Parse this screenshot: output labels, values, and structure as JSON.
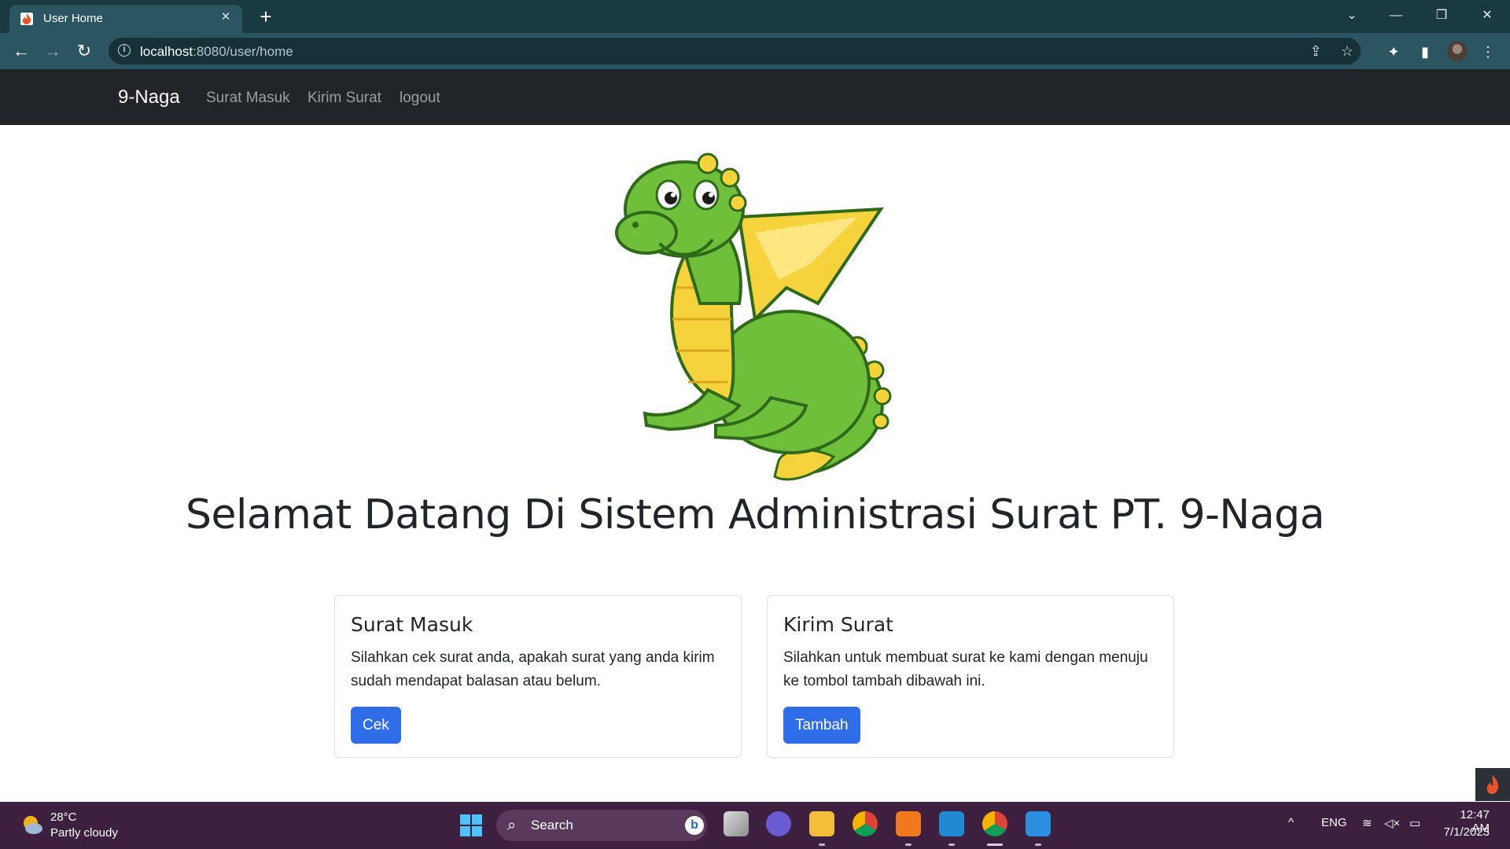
{
  "browser": {
    "tab_title": "User Home",
    "url_host": "localhost",
    "url_path": ":8080/user/home",
    "icons": [
      "back-icon",
      "forward-icon",
      "reload-icon",
      "info-icon",
      "share-icon",
      "star-icon",
      "extensions-icon",
      "side-panel-icon",
      "menu-icon"
    ]
  },
  "navbar": {
    "brand": "9-Naga",
    "links": [
      "Surat Masuk",
      "Kirim Surat",
      "logout"
    ]
  },
  "main": {
    "headline": "Selamat Datang Di Sistem Administrasi Surat PT. 9-Naga",
    "cards": [
      {
        "title": "Surat Masuk",
        "text": "Silahkan cek surat anda, apakah surat yang anda kirim sudah mendapat balasan atau belum.",
        "button": "Cek"
      },
      {
        "title": "Kirim Surat",
        "text": "Silahkan untuk membuat surat ke kami dengan menuju ke tombol tambah dibawah ini.",
        "button": "Tambah"
      }
    ],
    "button_color": "#2f6ee8"
  },
  "taskbar": {
    "weather_temp": "28°C",
    "weather_desc": "Partly cloudy",
    "search_label": "Search",
    "lang": "ENG",
    "time": "12:47 AM",
    "date": "7/1/2023"
  }
}
